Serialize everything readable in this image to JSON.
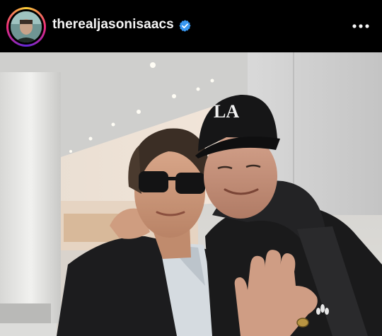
{
  "post": {
    "username": "therealjasonisaacs",
    "verified": true,
    "avatar_icon": "profile-avatar",
    "more_icon": "more-horizontal-icon",
    "verified_icon": "verified-badge-icon"
  },
  "photo": {
    "subject_icon": "photo"
  },
  "colors": {
    "background": "#000000",
    "text": "#f5f5f5",
    "verified_blue": "#3897f0"
  }
}
